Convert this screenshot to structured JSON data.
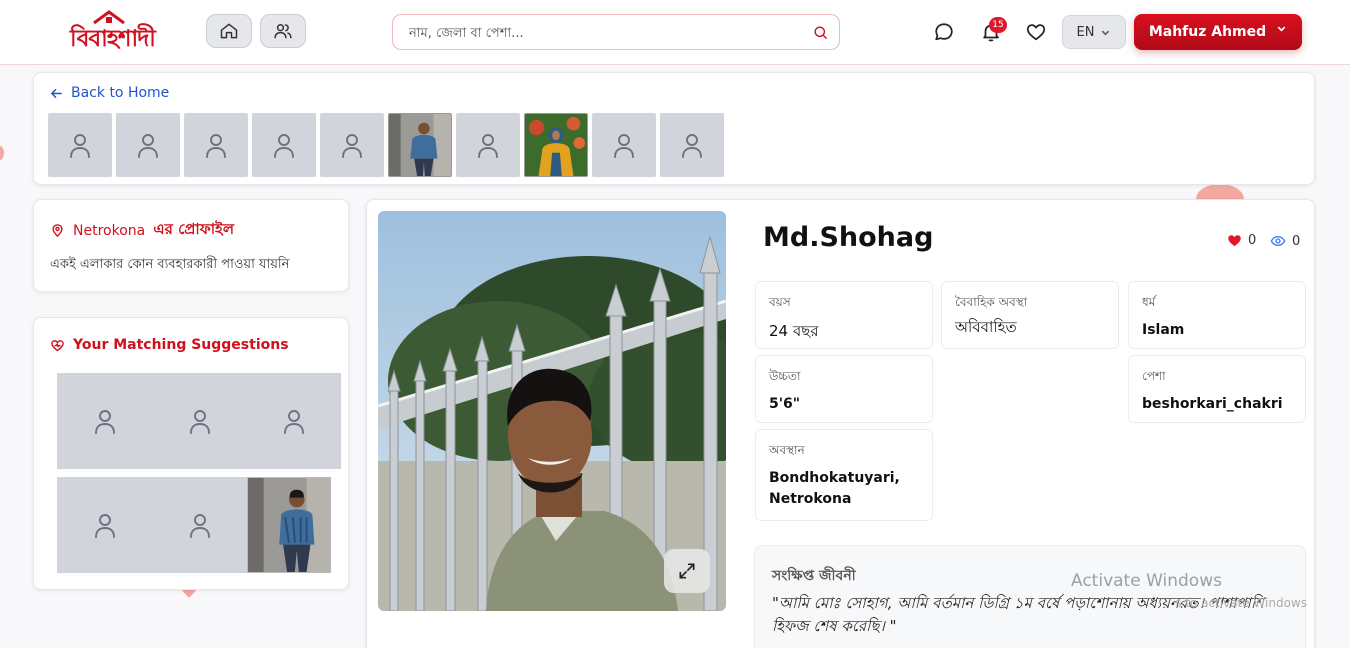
{
  "header": {
    "logo_text": "বিবাহশাদী",
    "search_placeholder": "নাম, জেলা বা পেশা...",
    "notification_count": "15",
    "language": "EN",
    "user_name": "Mahfuz Ahmed"
  },
  "gallery": {
    "back_label": "Back to Home",
    "thumbnails": [
      {
        "type": "placeholder"
      },
      {
        "type": "placeholder"
      },
      {
        "type": "placeholder"
      },
      {
        "type": "placeholder"
      },
      {
        "type": "placeholder"
      },
      {
        "type": "photo-man"
      },
      {
        "type": "placeholder"
      },
      {
        "type": "photo-woman"
      },
      {
        "type": "placeholder"
      },
      {
        "type": "placeholder"
      }
    ]
  },
  "area_profile": {
    "location": "Netrokona",
    "title_suffix": "এর প্রোফাইল",
    "message": "একই এলাকার কোন ব্যবহারকারী পাওয়া যায়নি"
  },
  "suggestions": {
    "title": "Your Matching Suggestions"
  },
  "profile": {
    "name": "Md.Shohag",
    "likes": "0",
    "views": "0",
    "age_label": "বয়স",
    "age_value": "24 বছর",
    "marital_label": "বৈবাহিক অবস্থা",
    "marital_value": "অবিবাহিত",
    "religion_label": "ধর্ম",
    "religion_value": "Islam",
    "height_label": "উচ্চতা",
    "height_value": "5'6\"",
    "profession_label": "পেশা",
    "profession_value": "beshorkari_chakri",
    "location_label": "অবস্থান",
    "location_value": "Bondhokatuyari, Netrokona",
    "bio_title": "সংক্ষিপ্ত জীবনী",
    "bio_text": "\"আমি মোঃ সোহাগ, আমি বর্তমান ডিগ্রি ১ম বর্ষে পড়াশোনায় অধ্যয়নরত। পাশাপাশি হিফজ শেষ করেছি। \""
  },
  "overlay": {
    "activate_title": "Activate Windows",
    "activate_sub": "Go to Settings to activate Windows."
  },
  "colors": {
    "brand_red": "#d0101c",
    "link_blue": "#1f55c9",
    "placeholder_gray": "#d1d5db"
  }
}
